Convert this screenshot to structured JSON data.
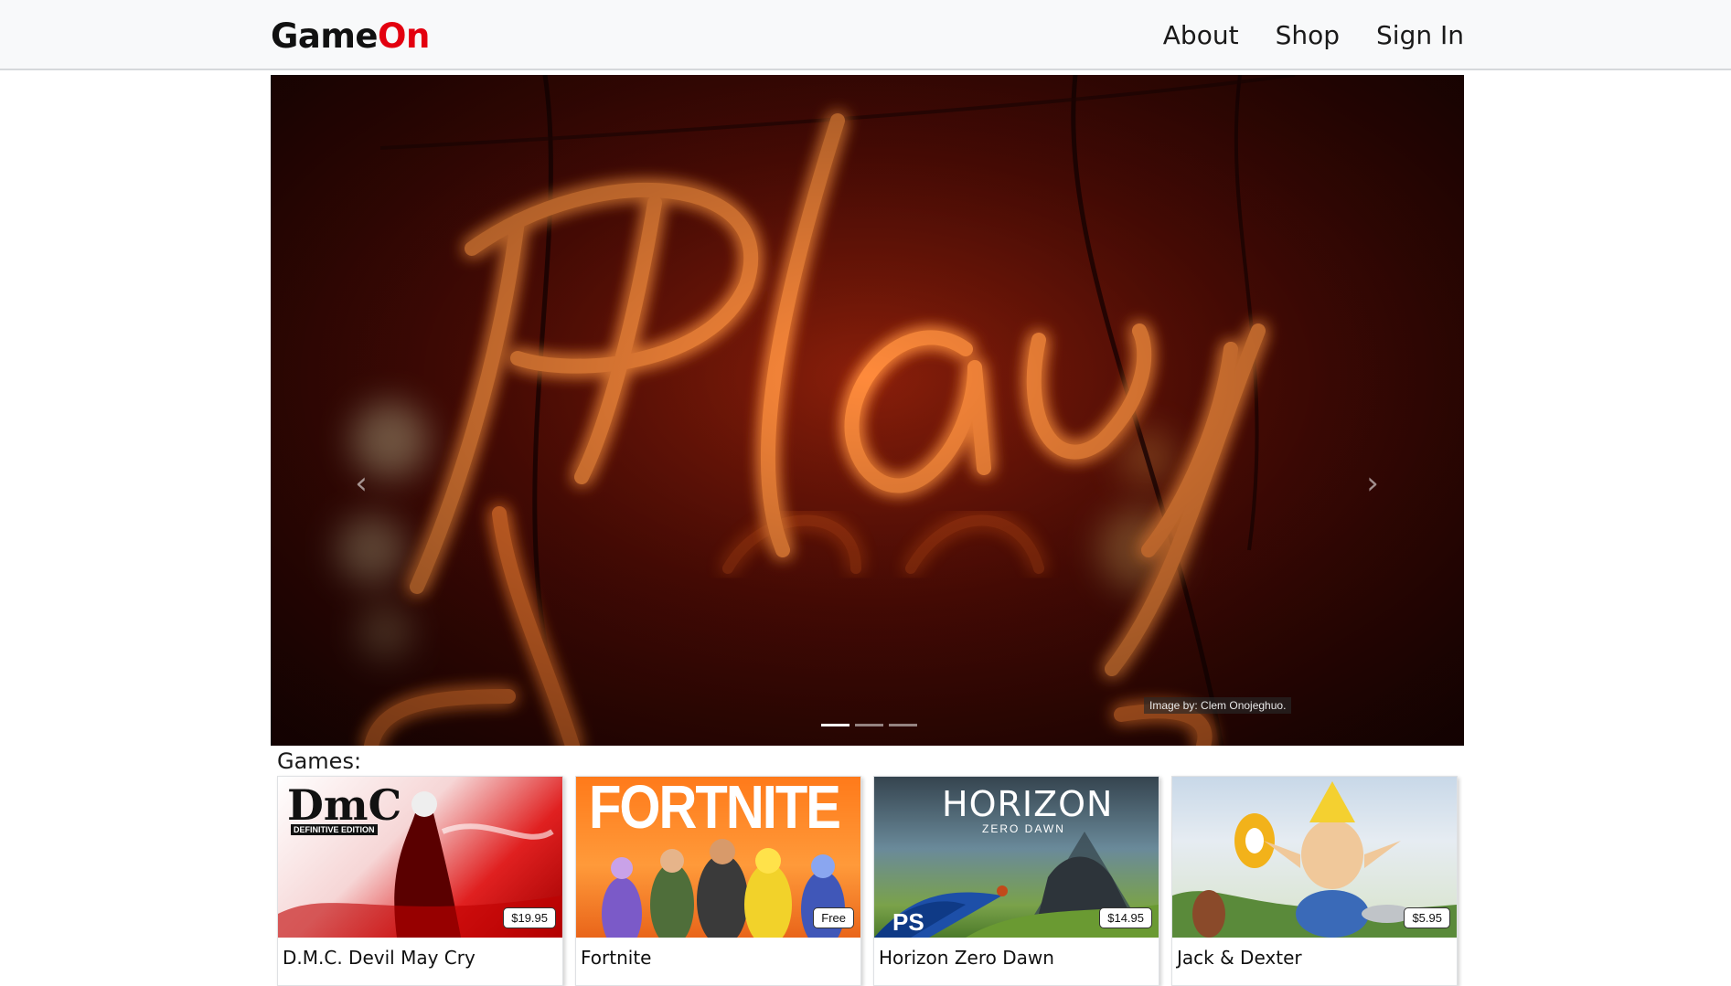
{
  "navbar": {
    "brand_part1": "Game",
    "brand_part2": "On",
    "links": [
      "About",
      "Shop",
      "Sign In"
    ]
  },
  "carousel": {
    "hero_text": "Play",
    "credit": "Image by: Clem Onojeghuo.",
    "prev_label": "‹",
    "next_label": "›",
    "slide_count": 3,
    "active_slide": 1
  },
  "games": {
    "heading": "Games:",
    "items": [
      {
        "title": "D.M.C. Devil May Cry",
        "price": "$19.95",
        "cover_text": "DmC",
        "cover_subtext": "DEFINITIVE EDITION"
      },
      {
        "title": "Fortnite",
        "price": "Free",
        "cover_text": "FORTNITE"
      },
      {
        "title": "Horizon Zero Dawn",
        "price": "$14.95",
        "cover_text": "HORIZON",
        "cover_subtext": "ZERO DAWN"
      },
      {
        "title": "Jack & Dexter",
        "price": "$5.95"
      }
    ]
  },
  "colors": {
    "brand_accent": "#e3000f",
    "navbar_bg": "#f8f9fa",
    "neon": "#ff7a2e"
  }
}
